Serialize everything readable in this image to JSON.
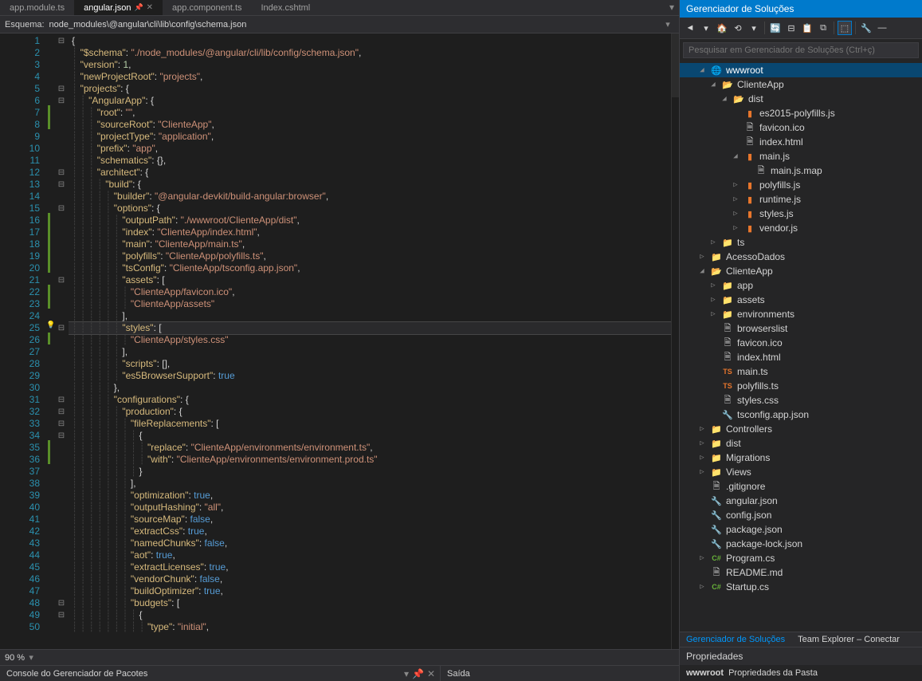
{
  "tabs": [
    {
      "label": "app.module.ts",
      "active": false
    },
    {
      "label": "angular.json",
      "active": true,
      "pinned": true
    },
    {
      "label": "app.component.ts",
      "active": false
    },
    {
      "label": "Index.cshtml",
      "active": false
    }
  ],
  "schema": {
    "label": "Esquema:",
    "path": "node_modules\\@angular\\cli\\lib\\config\\schema.json"
  },
  "zoom": "90 %",
  "bottom_panels": {
    "left": "Console do Gerenciador de Pacotes",
    "right": "Saída"
  },
  "solution_explorer": {
    "title": "Gerenciador de Soluções",
    "search_placeholder": "Pesquisar em Gerenciador de Soluções (Ctrl+ç)",
    "tabs": [
      {
        "label": "Gerenciador de Soluções",
        "active": true
      },
      {
        "label": "Team Explorer – Conectar",
        "active": false
      }
    ]
  },
  "properties": {
    "title": "Propriedades",
    "name": "wwwroot",
    "desc": "Propriedades da Pasta"
  },
  "tree": [
    {
      "depth": 0,
      "expand": "◢",
      "icon": "globe",
      "label": "wwwroot",
      "selected": true
    },
    {
      "depth": 1,
      "expand": "◢",
      "icon": "folder-open",
      "label": "ClienteApp"
    },
    {
      "depth": 2,
      "expand": "◢",
      "icon": "folder-open",
      "label": "dist"
    },
    {
      "depth": 3,
      "expand": "",
      "icon": "js",
      "label": "es2015-polyfills.js"
    },
    {
      "depth": 3,
      "expand": "",
      "icon": "file",
      "label": "favicon.ico"
    },
    {
      "depth": 3,
      "expand": "",
      "icon": "file",
      "label": "index.html"
    },
    {
      "depth": 3,
      "expand": "◢",
      "icon": "js",
      "label": "main.js"
    },
    {
      "depth": 4,
      "expand": "",
      "icon": "file",
      "label": "main.js.map"
    },
    {
      "depth": 3,
      "expand": "▷",
      "icon": "js",
      "label": "polyfills.js"
    },
    {
      "depth": 3,
      "expand": "▷",
      "icon": "js",
      "label": "runtime.js"
    },
    {
      "depth": 3,
      "expand": "▷",
      "icon": "js",
      "label": "styles.js"
    },
    {
      "depth": 3,
      "expand": "▷",
      "icon": "js",
      "label": "vendor.js"
    },
    {
      "depth": 1,
      "expand": "▷",
      "icon": "folder",
      "label": "ts"
    },
    {
      "depth": 0,
      "expand": "▷",
      "icon": "folder",
      "label": "AcessoDados"
    },
    {
      "depth": 0,
      "expand": "◢",
      "icon": "folder-open",
      "label": "ClienteApp"
    },
    {
      "depth": 1,
      "expand": "▷",
      "icon": "folder",
      "label": "app"
    },
    {
      "depth": 1,
      "expand": "▷",
      "icon": "folder",
      "label": "assets"
    },
    {
      "depth": 1,
      "expand": "▷",
      "icon": "folder",
      "label": "environments"
    },
    {
      "depth": 1,
      "expand": "",
      "icon": "file",
      "label": "browserslist"
    },
    {
      "depth": 1,
      "expand": "",
      "icon": "file",
      "label": "favicon.ico"
    },
    {
      "depth": 1,
      "expand": "",
      "icon": "file",
      "label": "index.html"
    },
    {
      "depth": 1,
      "expand": "",
      "icon": "ts",
      "label": "main.ts"
    },
    {
      "depth": 1,
      "expand": "",
      "icon": "ts",
      "label": "polyfills.ts"
    },
    {
      "depth": 1,
      "expand": "",
      "icon": "file",
      "label": "styles.css"
    },
    {
      "depth": 1,
      "expand": "",
      "icon": "json",
      "label": "tsconfig.app.json"
    },
    {
      "depth": 0,
      "expand": "▷",
      "icon": "folder",
      "label": "Controllers"
    },
    {
      "depth": 0,
      "expand": "▷",
      "icon": "folder",
      "label": "dist"
    },
    {
      "depth": 0,
      "expand": "▷",
      "icon": "folder",
      "label": "Migrations"
    },
    {
      "depth": 0,
      "expand": "▷",
      "icon": "folder",
      "label": "Views"
    },
    {
      "depth": 0,
      "expand": "",
      "icon": "file",
      "label": ".gitignore"
    },
    {
      "depth": 0,
      "expand": "",
      "icon": "json",
      "label": "angular.json"
    },
    {
      "depth": 0,
      "expand": "",
      "icon": "json",
      "label": "config.json"
    },
    {
      "depth": 0,
      "expand": "",
      "icon": "json",
      "label": "package.json"
    },
    {
      "depth": 0,
      "expand": "",
      "icon": "json",
      "label": "package-lock.json"
    },
    {
      "depth": 0,
      "expand": "▷",
      "icon": "cs",
      "label": "Program.cs"
    },
    {
      "depth": 0,
      "expand": "",
      "icon": "file",
      "label": "README.md"
    },
    {
      "depth": 0,
      "expand": "▷",
      "icon": "cs",
      "label": "Startup.cs"
    }
  ],
  "code_lines": [
    {
      "n": 1,
      "fold": "⊟",
      "tokens": [
        [
          "punct",
          "{"
        ]
      ]
    },
    {
      "n": 2,
      "tokens": [
        [
          "indent",
          "  "
        ],
        [
          "key",
          "\"$schema\""
        ],
        [
          "punct",
          ": "
        ],
        [
          "str",
          "\"./node_modules/@angular/cli/lib/config/schema.json\""
        ],
        [
          "punct",
          ","
        ]
      ]
    },
    {
      "n": 3,
      "tokens": [
        [
          "indent",
          "  "
        ],
        [
          "key",
          "\"version\""
        ],
        [
          "punct",
          ": "
        ],
        [
          "num",
          "1"
        ],
        [
          "punct",
          ","
        ]
      ]
    },
    {
      "n": 4,
      "tokens": [
        [
          "indent",
          "  "
        ],
        [
          "key",
          "\"newProjectRoot\""
        ],
        [
          "punct",
          ": "
        ],
        [
          "str",
          "\"projects\""
        ],
        [
          "punct",
          ","
        ]
      ]
    },
    {
      "n": 5,
      "fold": "⊟",
      "tokens": [
        [
          "indent",
          "  "
        ],
        [
          "key",
          "\"projects\""
        ],
        [
          "punct",
          ": {"
        ]
      ]
    },
    {
      "n": 6,
      "fold": "⊟",
      "tokens": [
        [
          "indent",
          "    "
        ],
        [
          "key",
          "\"AngularApp\""
        ],
        [
          "punct",
          ": {"
        ]
      ]
    },
    {
      "n": 7,
      "mark": "green",
      "tokens": [
        [
          "indent",
          "      "
        ],
        [
          "key",
          "\"root\""
        ],
        [
          "punct",
          ": "
        ],
        [
          "str",
          "\"\""
        ],
        [
          "punct",
          ","
        ]
      ]
    },
    {
      "n": 8,
      "mark": "green",
      "tokens": [
        [
          "indent",
          "      "
        ],
        [
          "key",
          "\"sourceRoot\""
        ],
        [
          "punct",
          ": "
        ],
        [
          "str",
          "\"ClienteApp\""
        ],
        [
          "punct",
          ","
        ]
      ]
    },
    {
      "n": 9,
      "tokens": [
        [
          "indent",
          "      "
        ],
        [
          "key",
          "\"projectType\""
        ],
        [
          "punct",
          ": "
        ],
        [
          "str",
          "\"application\""
        ],
        [
          "punct",
          ","
        ]
      ]
    },
    {
      "n": 10,
      "tokens": [
        [
          "indent",
          "      "
        ],
        [
          "key",
          "\"prefix\""
        ],
        [
          "punct",
          ": "
        ],
        [
          "str",
          "\"app\""
        ],
        [
          "punct",
          ","
        ]
      ]
    },
    {
      "n": 11,
      "tokens": [
        [
          "indent",
          "      "
        ],
        [
          "key",
          "\"schematics\""
        ],
        [
          "punct",
          ": {},"
        ]
      ]
    },
    {
      "n": 12,
      "fold": "⊟",
      "tokens": [
        [
          "indent",
          "      "
        ],
        [
          "key",
          "\"architect\""
        ],
        [
          "punct",
          ": {"
        ]
      ]
    },
    {
      "n": 13,
      "fold": "⊟",
      "tokens": [
        [
          "indent",
          "        "
        ],
        [
          "key",
          "\"build\""
        ],
        [
          "punct",
          ": {"
        ]
      ]
    },
    {
      "n": 14,
      "tokens": [
        [
          "indent",
          "          "
        ],
        [
          "key",
          "\"builder\""
        ],
        [
          "punct",
          ": "
        ],
        [
          "str",
          "\"@angular-devkit/build-angular:browser\""
        ],
        [
          "punct",
          ","
        ]
      ]
    },
    {
      "n": 15,
      "fold": "⊟",
      "tokens": [
        [
          "indent",
          "          "
        ],
        [
          "key",
          "\"options\""
        ],
        [
          "punct",
          ": {"
        ]
      ]
    },
    {
      "n": 16,
      "mark": "green",
      "tokens": [
        [
          "indent",
          "            "
        ],
        [
          "key",
          "\"outputPath\""
        ],
        [
          "punct",
          ": "
        ],
        [
          "str",
          "\"./wwwroot/ClienteApp/dist\""
        ],
        [
          "punct",
          ","
        ]
      ]
    },
    {
      "n": 17,
      "mark": "green",
      "tokens": [
        [
          "indent",
          "            "
        ],
        [
          "key",
          "\"index\""
        ],
        [
          "punct",
          ": "
        ],
        [
          "str",
          "\"ClienteApp/index.html\""
        ],
        [
          "punct",
          ","
        ]
      ]
    },
    {
      "n": 18,
      "mark": "green",
      "tokens": [
        [
          "indent",
          "            "
        ],
        [
          "key",
          "\"main\""
        ],
        [
          "punct",
          ": "
        ],
        [
          "str",
          "\"ClienteApp/main.ts\""
        ],
        [
          "punct",
          ","
        ]
      ]
    },
    {
      "n": 19,
      "mark": "green",
      "tokens": [
        [
          "indent",
          "            "
        ],
        [
          "key",
          "\"polyfills\""
        ],
        [
          "punct",
          ": "
        ],
        [
          "str",
          "\"ClienteApp/polyfills.ts\""
        ],
        [
          "punct",
          ","
        ]
      ]
    },
    {
      "n": 20,
      "mark": "green",
      "tokens": [
        [
          "indent",
          "            "
        ],
        [
          "key",
          "\"tsConfig\""
        ],
        [
          "punct",
          ": "
        ],
        [
          "str",
          "\"ClienteApp/tsconfig.app.json\""
        ],
        [
          "punct",
          ","
        ]
      ]
    },
    {
      "n": 21,
      "fold": "⊟",
      "tokens": [
        [
          "indent",
          "            "
        ],
        [
          "key",
          "\"assets\""
        ],
        [
          "punct",
          ": ["
        ]
      ]
    },
    {
      "n": 22,
      "mark": "green",
      "tokens": [
        [
          "indent",
          "              "
        ],
        [
          "str",
          "\"ClienteApp/favicon.ico\""
        ],
        [
          "punct",
          ","
        ]
      ]
    },
    {
      "n": 23,
      "mark": "green",
      "tokens": [
        [
          "indent",
          "              "
        ],
        [
          "str",
          "\"ClienteApp/assets\""
        ]
      ]
    },
    {
      "n": 24,
      "tokens": [
        [
          "indent",
          "            "
        ],
        [
          "punct",
          "],"
        ]
      ]
    },
    {
      "n": 25,
      "fold": "⊟",
      "mark": "bulb",
      "highlight": true,
      "tokens": [
        [
          "indent",
          "            "
        ],
        [
          "key",
          "\"styles\""
        ],
        [
          "punct",
          ": ["
        ]
      ]
    },
    {
      "n": 26,
      "mark": "green",
      "tokens": [
        [
          "indent",
          "              "
        ],
        [
          "str",
          "\"ClienteApp/styles.css\""
        ]
      ]
    },
    {
      "n": 27,
      "tokens": [
        [
          "indent",
          "            "
        ],
        [
          "punct",
          "],"
        ]
      ]
    },
    {
      "n": 28,
      "tokens": [
        [
          "indent",
          "            "
        ],
        [
          "key",
          "\"scripts\""
        ],
        [
          "punct",
          ": [],"
        ]
      ]
    },
    {
      "n": 29,
      "tokens": [
        [
          "indent",
          "            "
        ],
        [
          "key",
          "\"es5BrowserSupport\""
        ],
        [
          "punct",
          ": "
        ],
        [
          "bool",
          "true"
        ]
      ]
    },
    {
      "n": 30,
      "tokens": [
        [
          "indent",
          "          "
        ],
        [
          "punct",
          "},"
        ]
      ]
    },
    {
      "n": 31,
      "fold": "⊟",
      "tokens": [
        [
          "indent",
          "          "
        ],
        [
          "key",
          "\"configurations\""
        ],
        [
          "punct",
          ": {"
        ]
      ]
    },
    {
      "n": 32,
      "fold": "⊟",
      "tokens": [
        [
          "indent",
          "            "
        ],
        [
          "key",
          "\"production\""
        ],
        [
          "punct",
          ": {"
        ]
      ]
    },
    {
      "n": 33,
      "fold": "⊟",
      "tokens": [
        [
          "indent",
          "              "
        ],
        [
          "key",
          "\"fileReplacements\""
        ],
        [
          "punct",
          ": ["
        ]
      ]
    },
    {
      "n": 34,
      "fold": "⊟",
      "tokens": [
        [
          "indent",
          "                "
        ],
        [
          "punct",
          "{"
        ]
      ]
    },
    {
      "n": 35,
      "mark": "green",
      "tokens": [
        [
          "indent",
          "                  "
        ],
        [
          "key",
          "\"replace\""
        ],
        [
          "punct",
          ": "
        ],
        [
          "str",
          "\"ClienteApp/environments/environment.ts\""
        ],
        [
          "punct",
          ","
        ]
      ]
    },
    {
      "n": 36,
      "mark": "green",
      "tokens": [
        [
          "indent",
          "                  "
        ],
        [
          "key",
          "\"with\""
        ],
        [
          "punct",
          ": "
        ],
        [
          "str",
          "\"ClienteApp/environments/environment.prod.ts\""
        ]
      ]
    },
    {
      "n": 37,
      "tokens": [
        [
          "indent",
          "                "
        ],
        [
          "punct",
          "}"
        ]
      ]
    },
    {
      "n": 38,
      "tokens": [
        [
          "indent",
          "              "
        ],
        [
          "punct",
          "],"
        ]
      ]
    },
    {
      "n": 39,
      "tokens": [
        [
          "indent",
          "              "
        ],
        [
          "key",
          "\"optimization\""
        ],
        [
          "punct",
          ": "
        ],
        [
          "bool",
          "true"
        ],
        [
          "punct",
          ","
        ]
      ]
    },
    {
      "n": 40,
      "tokens": [
        [
          "indent",
          "              "
        ],
        [
          "key",
          "\"outputHashing\""
        ],
        [
          "punct",
          ": "
        ],
        [
          "str",
          "\"all\""
        ],
        [
          "punct",
          ","
        ]
      ]
    },
    {
      "n": 41,
      "tokens": [
        [
          "indent",
          "              "
        ],
        [
          "key",
          "\"sourceMap\""
        ],
        [
          "punct",
          ": "
        ],
        [
          "bool",
          "false"
        ],
        [
          "punct",
          ","
        ]
      ]
    },
    {
      "n": 42,
      "tokens": [
        [
          "indent",
          "              "
        ],
        [
          "key",
          "\"extractCss\""
        ],
        [
          "punct",
          ": "
        ],
        [
          "bool",
          "true"
        ],
        [
          "punct",
          ","
        ]
      ]
    },
    {
      "n": 43,
      "tokens": [
        [
          "indent",
          "              "
        ],
        [
          "key",
          "\"namedChunks\""
        ],
        [
          "punct",
          ": "
        ],
        [
          "bool",
          "false"
        ],
        [
          "punct",
          ","
        ]
      ]
    },
    {
      "n": 44,
      "tokens": [
        [
          "indent",
          "              "
        ],
        [
          "key",
          "\"aot\""
        ],
        [
          "punct",
          ": "
        ],
        [
          "bool",
          "true"
        ],
        [
          "punct",
          ","
        ]
      ]
    },
    {
      "n": 45,
      "tokens": [
        [
          "indent",
          "              "
        ],
        [
          "key",
          "\"extractLicenses\""
        ],
        [
          "punct",
          ": "
        ],
        [
          "bool",
          "true"
        ],
        [
          "punct",
          ","
        ]
      ]
    },
    {
      "n": 46,
      "tokens": [
        [
          "indent",
          "              "
        ],
        [
          "key",
          "\"vendorChunk\""
        ],
        [
          "punct",
          ": "
        ],
        [
          "bool",
          "false"
        ],
        [
          "punct",
          ","
        ]
      ]
    },
    {
      "n": 47,
      "tokens": [
        [
          "indent",
          "              "
        ],
        [
          "key",
          "\"buildOptimizer\""
        ],
        [
          "punct",
          ": "
        ],
        [
          "bool",
          "true"
        ],
        [
          "punct",
          ","
        ]
      ]
    },
    {
      "n": 48,
      "fold": "⊟",
      "tokens": [
        [
          "indent",
          "              "
        ],
        [
          "key",
          "\"budgets\""
        ],
        [
          "punct",
          ": ["
        ]
      ]
    },
    {
      "n": 49,
      "fold": "⊟",
      "tokens": [
        [
          "indent",
          "                "
        ],
        [
          "punct",
          "{"
        ]
      ]
    },
    {
      "n": 50,
      "tokens": [
        [
          "indent",
          "                  "
        ],
        [
          "key",
          "\"type\""
        ],
        [
          "punct",
          ": "
        ],
        [
          "str",
          "\"initial\""
        ],
        [
          "punct",
          ","
        ]
      ]
    }
  ]
}
